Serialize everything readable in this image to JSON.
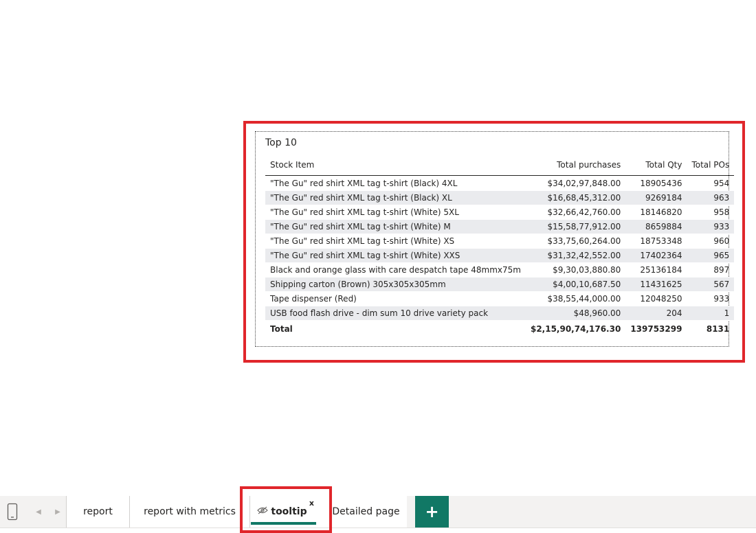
{
  "visual": {
    "title": "Top 10",
    "columns": {
      "stock_item": "Stock Item",
      "total_purchases": "Total purchases",
      "total_qty": "Total Qty",
      "total_pos": "Total POs"
    },
    "rows": [
      {
        "item": "\"The Gu\" red shirt XML tag t-shirt (Black) 4XL",
        "purchases": "$34,02,97,848.00",
        "qty": "18905436",
        "pos": "954"
      },
      {
        "item": "\"The Gu\" red shirt XML tag t-shirt (Black) XL",
        "purchases": "$16,68,45,312.00",
        "qty": "9269184",
        "pos": "963"
      },
      {
        "item": "\"The Gu\" red shirt XML tag t-shirt (White) 5XL",
        "purchases": "$32,66,42,760.00",
        "qty": "18146820",
        "pos": "958"
      },
      {
        "item": "\"The Gu\" red shirt XML tag t-shirt (White) M",
        "purchases": "$15,58,77,912.00",
        "qty": "8659884",
        "pos": "933"
      },
      {
        "item": "\"The Gu\" red shirt XML tag t-shirt (White) XS",
        "purchases": "$33,75,60,264.00",
        "qty": "18753348",
        "pos": "960"
      },
      {
        "item": "\"The Gu\" red shirt XML tag t-shirt (White) XXS",
        "purchases": "$31,32,42,552.00",
        "qty": "17402364",
        "pos": "965"
      },
      {
        "item": "Black and orange glass with care despatch tape 48mmx75m",
        "purchases": "$9,30,03,880.80",
        "qty": "25136184",
        "pos": "897"
      },
      {
        "item": "Shipping carton (Brown) 305x305x305mm",
        "purchases": "$4,00,10,687.50",
        "qty": "11431625",
        "pos": "567"
      },
      {
        "item": "Tape dispenser (Red)",
        "purchases": "$38,55,44,000.00",
        "qty": "12048250",
        "pos": "933"
      },
      {
        "item": "USB food flash drive - dim sum 10 drive variety pack",
        "purchases": "$48,960.00",
        "qty": "204",
        "pos": "1"
      }
    ],
    "total": {
      "label": "Total",
      "purchases": "$2,15,90,74,176.30",
      "qty": "139753299",
      "pos": "8131"
    }
  },
  "tabs": {
    "report": "report",
    "report_with_metrics": "report with metrics",
    "tooltip": "tooltip",
    "tooltip_close": "x",
    "detailed_page": "Detailed page",
    "add_page": "+"
  },
  "colors": {
    "accent": "#117865",
    "highlight": "#e0262b",
    "alt_row": "#eaebee"
  },
  "icons": {
    "device": "mobile-layout-icon",
    "prev": "chevron-left-icon",
    "next": "chevron-right-icon",
    "hidden": "eye-hidden-icon"
  }
}
